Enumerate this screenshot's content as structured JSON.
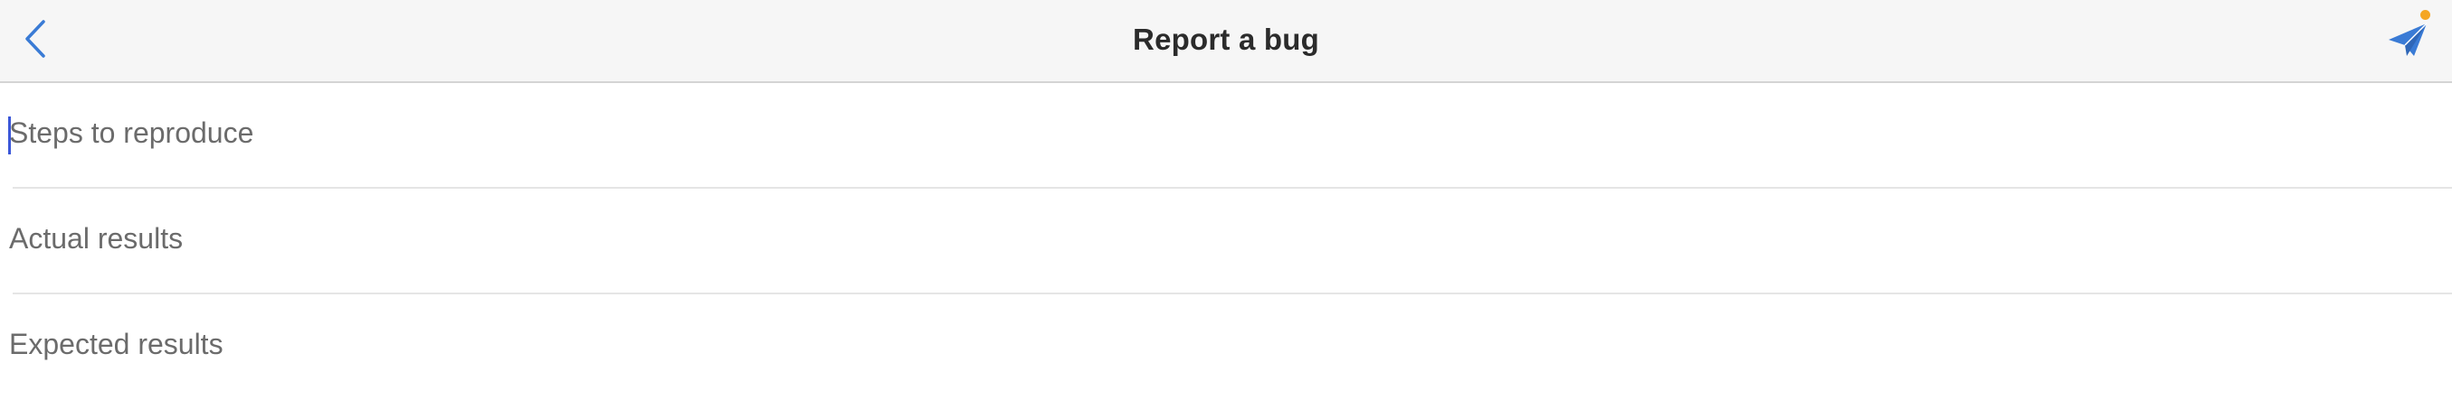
{
  "header": {
    "title": "Report a bug",
    "back_icon": "chevron-left-icon",
    "send_icon": "paper-plane-icon"
  },
  "fields": [
    {
      "placeholder": "Steps to reproduce"
    },
    {
      "placeholder": "Actual results"
    },
    {
      "placeholder": "Expected results"
    }
  ],
  "colors": {
    "accent": "#3a7bd5",
    "badge": "#f5a623",
    "caret": "#3b57d8",
    "placeholder_text": "#6b6b6b",
    "nav_background": "#f6f6f6"
  }
}
